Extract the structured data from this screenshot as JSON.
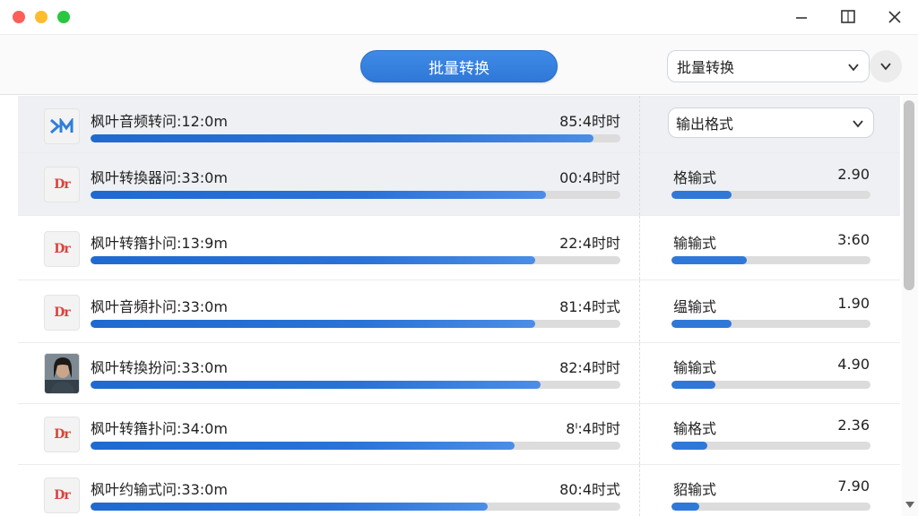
{
  "toolbar": {
    "convert_label": "批量转换",
    "mode_select_value": "批量转换"
  },
  "format_header": {
    "select_value": "输出格式"
  },
  "colors": {
    "accent": "#2f78d8",
    "track": "#dcdcdc",
    "logo_red": "#d9433c",
    "logo_blue": "#2f7fd8"
  },
  "rows": [
    {
      "name": "枫叶音频转问:12:0m",
      "time": "85:4时时",
      "progress": 0.95,
      "icon": "dm-blue-logo-icon",
      "logo": "DM"
    },
    {
      "name": "枫叶转換器问:33:0m",
      "time": "00:4时时",
      "progress": 0.86,
      "icon": "dm-red-logo-icon",
      "logo": "Dr",
      "fmt_label": "格输式",
      "fmt_value": "2.90",
      "fmt_progress": 0.3
    },
    {
      "name": "枫叶转簎扑问:13:9m",
      "time": "22:4时时",
      "progress": 0.84,
      "icon": "dm-red-logo-icon",
      "logo": "Dr",
      "fmt_label": "输输式",
      "fmt_value": "3:60",
      "fmt_progress": 0.38
    },
    {
      "name": "枫叶音頻扑问:33:0m",
      "time": "81:4时式",
      "progress": 0.84,
      "icon": "dm-red-logo-icon",
      "logo": "Dr",
      "fmt_label": "缊输式",
      "fmt_value": "1.90",
      "fmt_progress": 0.3
    },
    {
      "name": "枫叶转換扮问:33:0m",
      "time": "82:4时时",
      "progress": 0.85,
      "icon": "person-photo-icon",
      "logo": "",
      "fmt_label": "输输式",
      "fmt_value": "4.90",
      "fmt_progress": 0.22
    },
    {
      "name": "枫叶转簎扑问:34:0m",
      "time": "8ᴵ:4时时",
      "progress": 0.8,
      "icon": "dm-red-logo-icon",
      "logo": "Dr",
      "fmt_label": "输格式",
      "fmt_value": "2.36",
      "fmt_progress": 0.18
    },
    {
      "name": "枫叶约输式问:33:0m",
      "time": "80:4时式",
      "progress": 0.75,
      "icon": "dm-red-logo-icon",
      "logo": "Dr",
      "fmt_label": "貂输式",
      "fmt_value": "7.90",
      "fmt_progress": 0.14
    }
  ]
}
